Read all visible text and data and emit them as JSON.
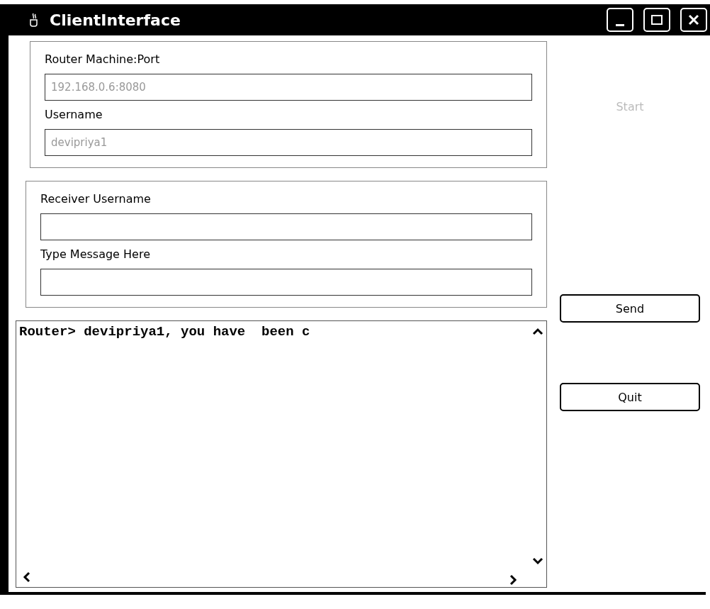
{
  "window": {
    "title": "ClientInterface"
  },
  "connection_panel": {
    "fields": [
      {
        "label": "Router Machine:Port",
        "value": "192.168.0.6:8080",
        "disabled": true
      },
      {
        "label": "Username",
        "value": "devipriya1",
        "disabled": true
      }
    ]
  },
  "message_panel": {
    "fields": [
      {
        "label": "Receiver Username"
      },
      {
        "label": "Type Message Here"
      }
    ]
  },
  "log": {
    "lines": [
      "Router> devipriya1, you have  been c"
    ]
  },
  "buttons": [
    {
      "label": "Start",
      "disabled": true
    },
    {
      "label": "Send",
      "disabled": false
    },
    {
      "label": "Quit",
      "disabled": false
    }
  ]
}
